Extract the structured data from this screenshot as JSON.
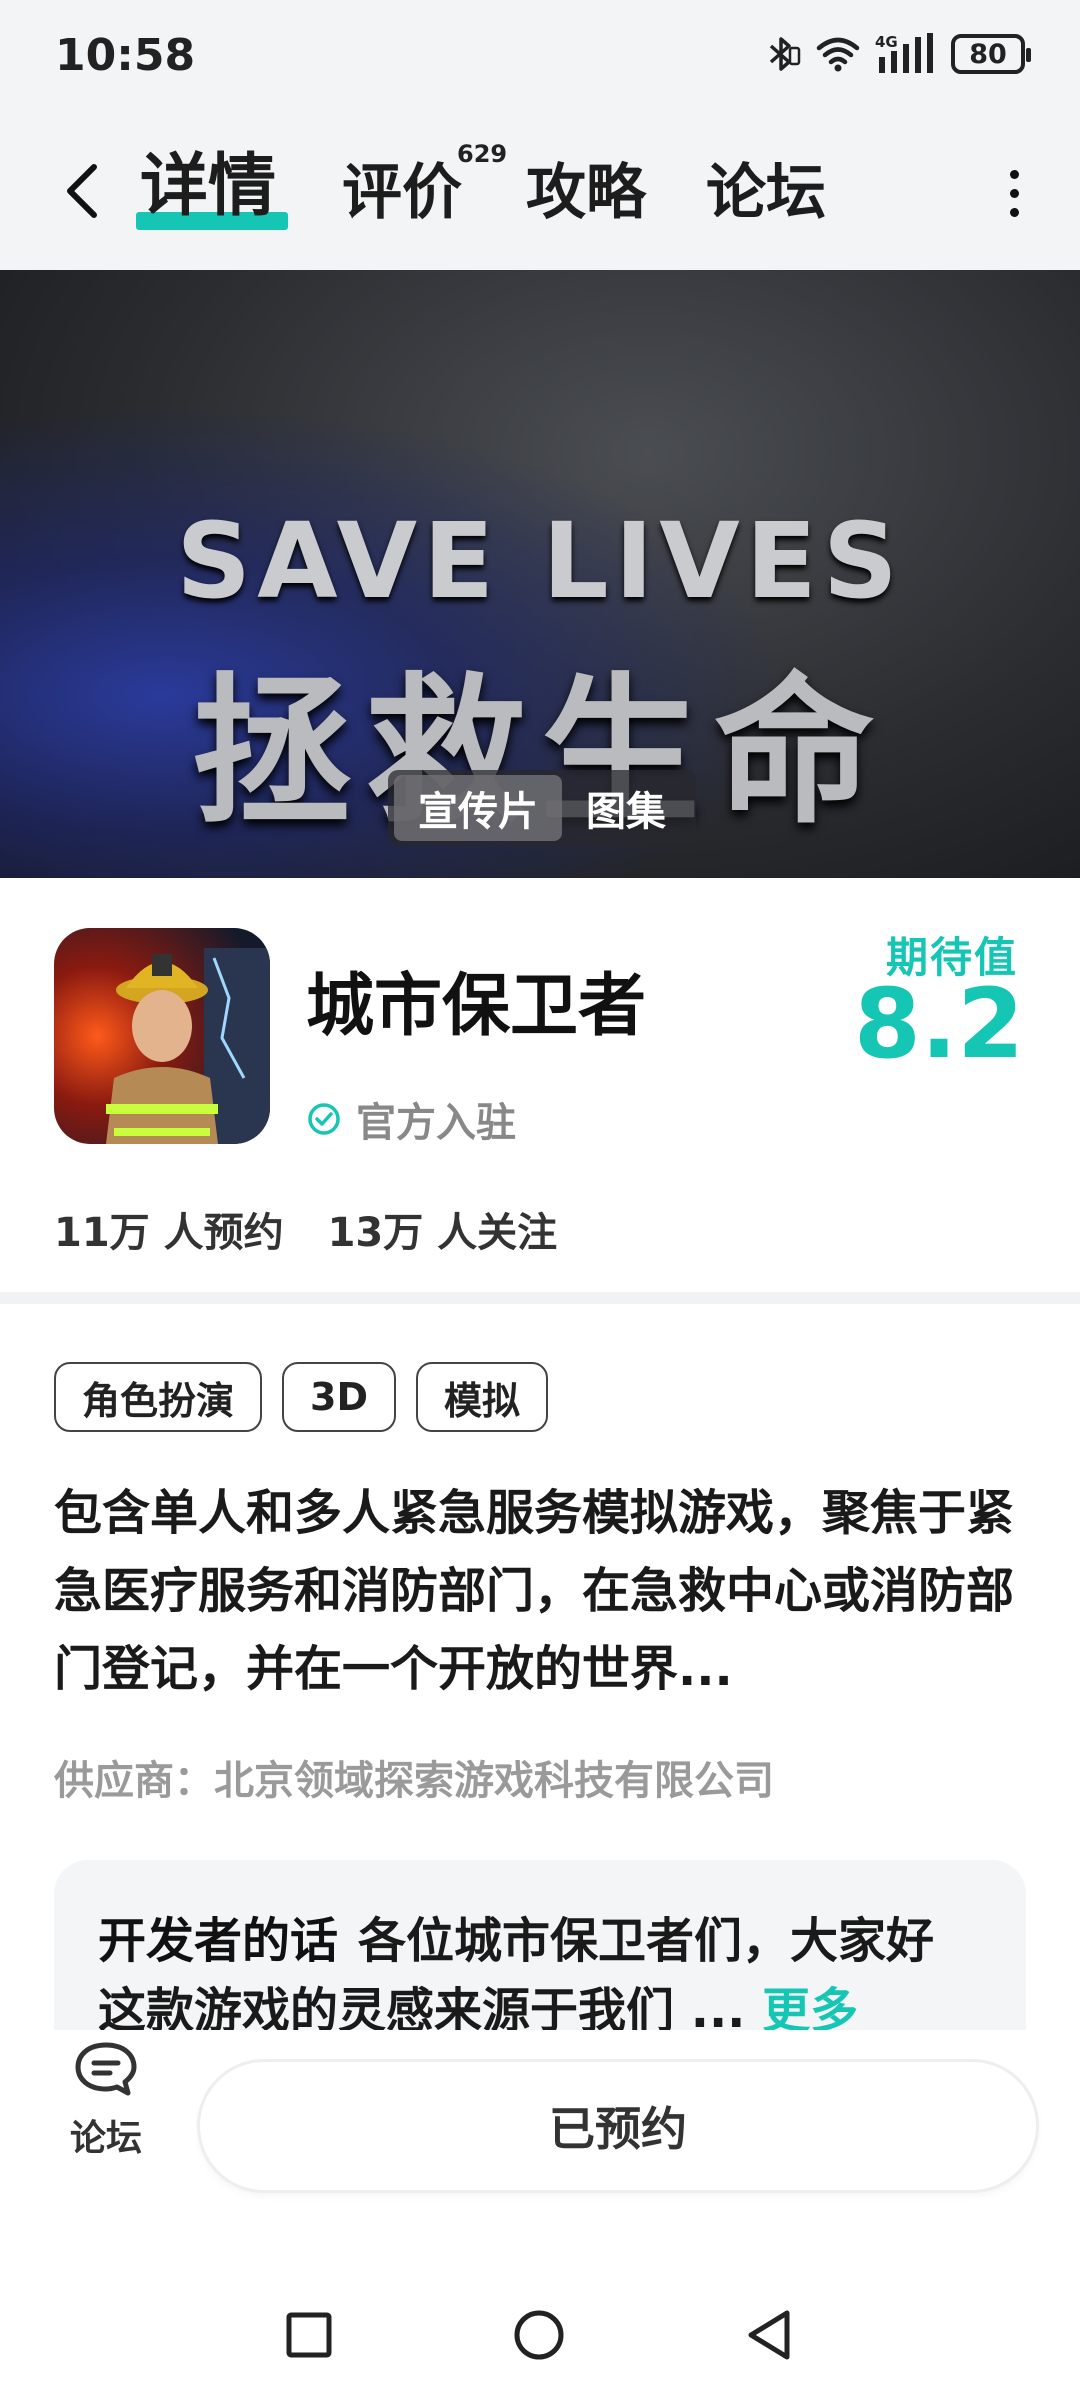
{
  "status_bar": {
    "time": "10:58",
    "battery": "80",
    "network": "4G"
  },
  "nav": {
    "tabs": [
      {
        "label": "详情",
        "active": true
      },
      {
        "label": "评价",
        "badge": "629"
      },
      {
        "label": "攻略"
      },
      {
        "label": "论坛"
      }
    ]
  },
  "banner": {
    "headline_en": "SAVE LIVES",
    "headline_zh": "拯救生命",
    "media_tabs": [
      {
        "label": "宣传片",
        "active": true
      },
      {
        "label": "图集"
      }
    ]
  },
  "game": {
    "title": "城市保卫者",
    "official_label": "官方入驻",
    "expect_label": "期待值",
    "expect_value": "8.2",
    "reservations": "11万 人预约",
    "followers": "13万 人关注",
    "tags": [
      "角色扮演",
      "3D",
      "模拟"
    ],
    "description": "包含单人和多人紧急服务模拟游戏，聚焦于紧急医疗服务和消防部门，在急救中心或消防部门登记，并在一个开放的世界...",
    "supplier": "供应商：北京领域探索游戏科技有限公司"
  },
  "developer_note": {
    "label": "开发者的话",
    "text": "各位城市保卫者们，大家好 这款游戏的灵感来源于我们 ...",
    "more": "更多"
  },
  "bottom_bar": {
    "forum_label": "论坛",
    "reserve_button": "已预约"
  },
  "colors": {
    "accent": "#16c6b4"
  }
}
